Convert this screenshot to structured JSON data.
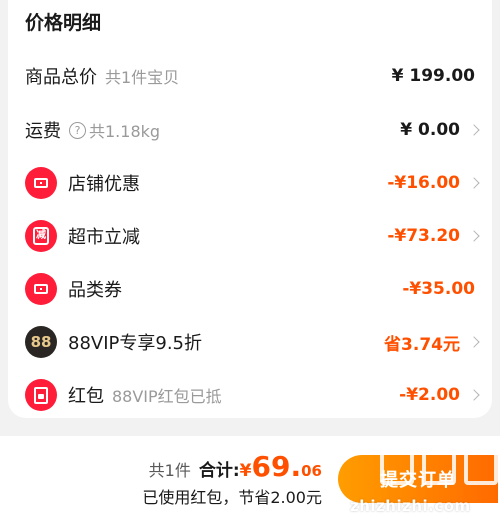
{
  "header": {
    "title": "价格明细"
  },
  "rows": [
    {
      "label": "商品总价",
      "sub": "共1件宝贝",
      "amount": "¥ 199.00"
    },
    {
      "label": "运费",
      "help": "?",
      "sub": "共1.18kg",
      "amount": "¥ 0.00"
    },
    {
      "label": "店铺优惠",
      "amount": "-¥16.00",
      "icon": "ticket-icon"
    },
    {
      "label": "超市立减",
      "icon_text": "减",
      "amount": "-¥73.20",
      "icon": "discount-icon"
    },
    {
      "label": "品类券",
      "amount": "-¥35.00",
      "icon": "coupon-icon"
    },
    {
      "label": "88VIP专享9.5折",
      "icon_text": "88",
      "amount": "省3.74元",
      "icon": "vip-88-icon"
    },
    {
      "label": "红包",
      "sub": "88VIP红包已抵",
      "amount": "-¥2.00",
      "icon": "red-packet-icon"
    }
  ],
  "footer": {
    "count": "共1件",
    "total_label": "合计:",
    "currency": "¥",
    "total_int": "69.",
    "total_dec": "06",
    "saving": "已使用红包，节省2.00元",
    "submit_label": "提交订单",
    "watermark": "zhizhizhi.com"
  },
  "colors": {
    "accent": "#ff5000",
    "icon_red": "#ff1d3a",
    "button_start": "#ff9d00",
    "button_end": "#ff6a00"
  }
}
